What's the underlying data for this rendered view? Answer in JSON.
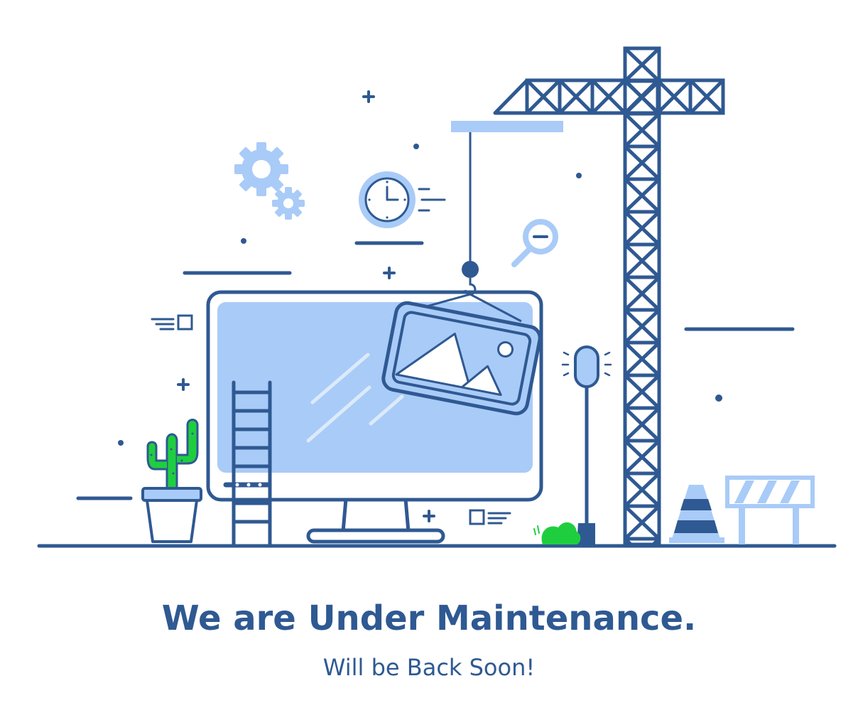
{
  "page": {
    "title": "We are Under Maintenance.",
    "subtitle": "Will be Back Soon!"
  },
  "colors": {
    "primary": "#2f5992",
    "light_blue": "#a9cbf7",
    "green": "#1fce3f",
    "background": "#ffffff"
  },
  "illustration": {
    "icons": [
      "gear-icon",
      "clock-icon",
      "magnifier-minus-icon",
      "image-icon",
      "crane-icon",
      "monitor-icon",
      "ladder-icon",
      "cactus-icon",
      "traffic-cone-icon",
      "barrier-icon",
      "lamp-icon",
      "bush-icon",
      "plus-icon"
    ]
  }
}
